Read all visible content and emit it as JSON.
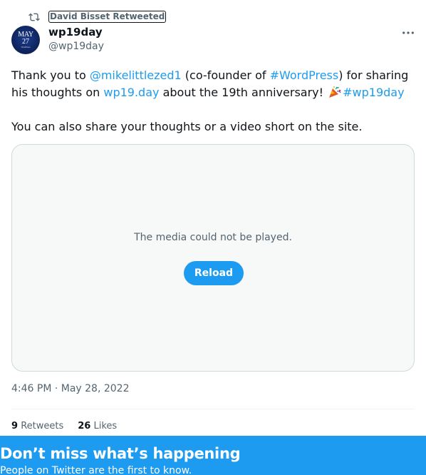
{
  "retweet": {
    "by": "David Bisset Retweeted",
    "icon": "retweet-icon"
  },
  "author": {
    "name": "wp19day",
    "handle": "@wp19day",
    "avatar_text": {
      "month": "MAY",
      "day": "27",
      "small": "WordPress"
    }
  },
  "tweet": {
    "p1_a": "Thank you to ",
    "mention": "@mikelittlezed1",
    "p1_b": " (co-founder of ",
    "hashtag1": "#WordPress",
    "p1_c": ") for sharing his thoughts on ",
    "url": "wp19.day",
    "p1_d": " about the 19th anniversary! ",
    "emoji": "party-popper-icon",
    "hashtag2": "#wp19day",
    "p2": "You can also share your thoughts or a video short on the site."
  },
  "media": {
    "message": "The media could not be played.",
    "reload_label": "Reload"
  },
  "timestamp": "4:46 PM · May 28, 2022",
  "stats": {
    "retweets_count": "9",
    "retweets_label": "Retweets",
    "likes_count": "26",
    "likes_label": "Likes"
  },
  "banner": {
    "title": "Don’t miss what’s happening",
    "subtitle": "People on Twitter are the first to know."
  },
  "colors": {
    "accent": "#1d9bf0",
    "text": "#0f1419",
    "secondary": "#536471"
  }
}
